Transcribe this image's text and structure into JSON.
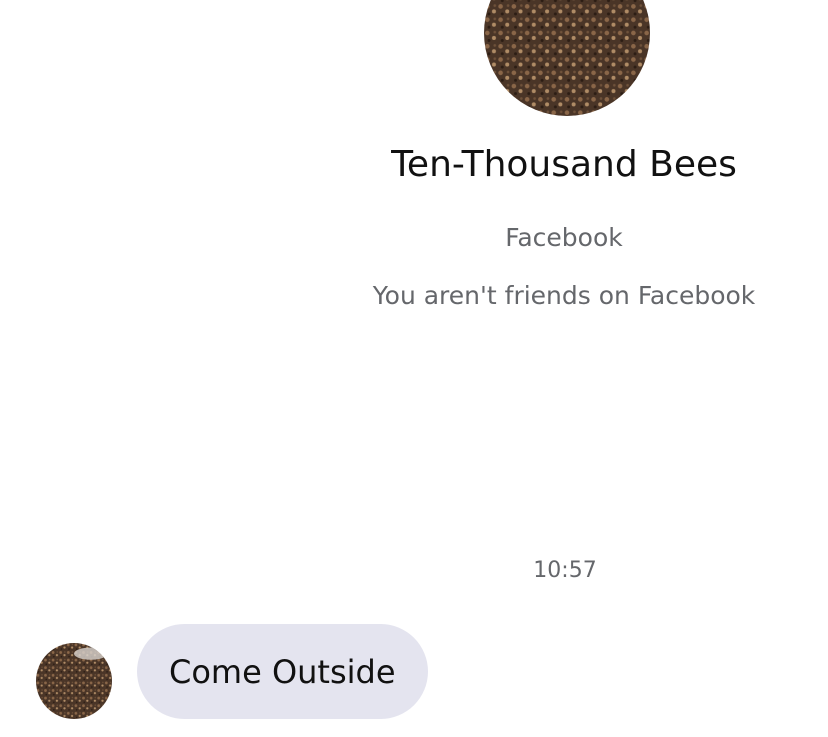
{
  "conversation": {
    "contact": {
      "name": "Ten-Thousand Bees",
      "source": "Facebook",
      "friend_status": "You aren't friends on Facebook",
      "avatar_icon": "bee-swarm-avatar"
    },
    "messages": [
      {
        "timestamp": "10:57",
        "sender": "contact",
        "text": "Come Outside"
      }
    ]
  },
  "colors": {
    "background": "#ffffff",
    "bubble": "#e4e4ef",
    "secondary_text": "#65676b",
    "avatar_base": "#4a3527"
  }
}
